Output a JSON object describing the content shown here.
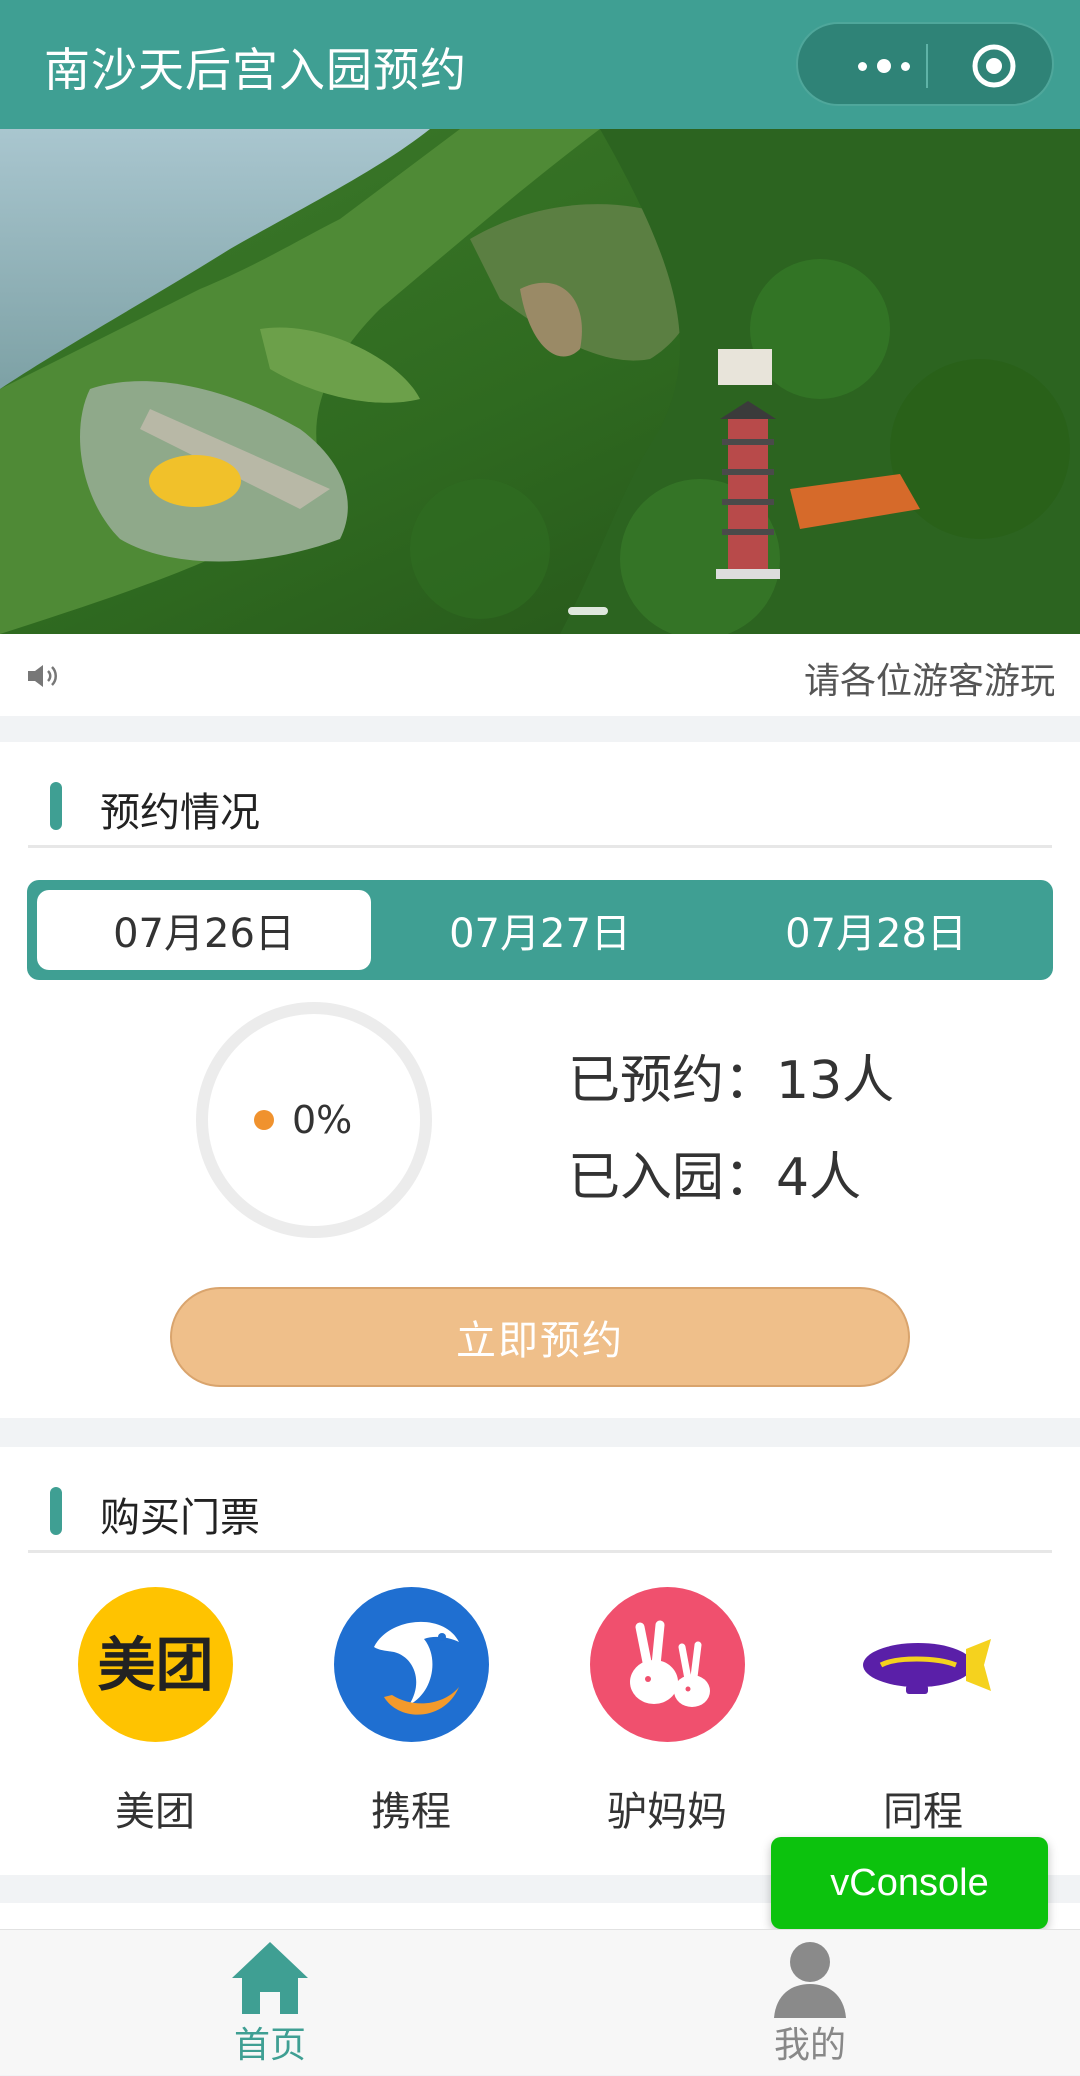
{
  "header": {
    "title": "南沙天后宫入园预约"
  },
  "banner": {
    "image_alt": "南沙天后宫 aerial view",
    "active_indicator": 1
  },
  "notice": {
    "text": "请各位游客游玩"
  },
  "reservation": {
    "section_title": "预约情况",
    "dates": [
      "07月26日",
      "07月27日",
      "07月28日"
    ],
    "selected_index": 0,
    "progress_text": "0%",
    "progress_value": 0,
    "booked": "已预约：13人",
    "entered": "已入园：4人",
    "reserve_button": "立即预约"
  },
  "tickets": {
    "section_title": "购买门票",
    "platforms": [
      {
        "name": "美团",
        "logo_text": "美团",
        "icon": "meituan-logo"
      },
      {
        "name": "携程",
        "icon": "ctrip-dolphin-logo"
      },
      {
        "name": "驴妈妈",
        "icon": "lvmama-donkey-logo"
      },
      {
        "name": "同程",
        "icon": "tongcheng-blimp-logo"
      }
    ]
  },
  "vconsole": {
    "label": "vConsole"
  },
  "tabbar": {
    "items": [
      {
        "label": "首页",
        "icon": "home-icon"
      },
      {
        "label": "我的",
        "icon": "user-icon"
      }
    ]
  },
  "colors": {
    "primary": "#3f9f93",
    "button": "#efbf8a",
    "progress_dot": "#f0922e",
    "vconsole": "#0cc20d"
  }
}
